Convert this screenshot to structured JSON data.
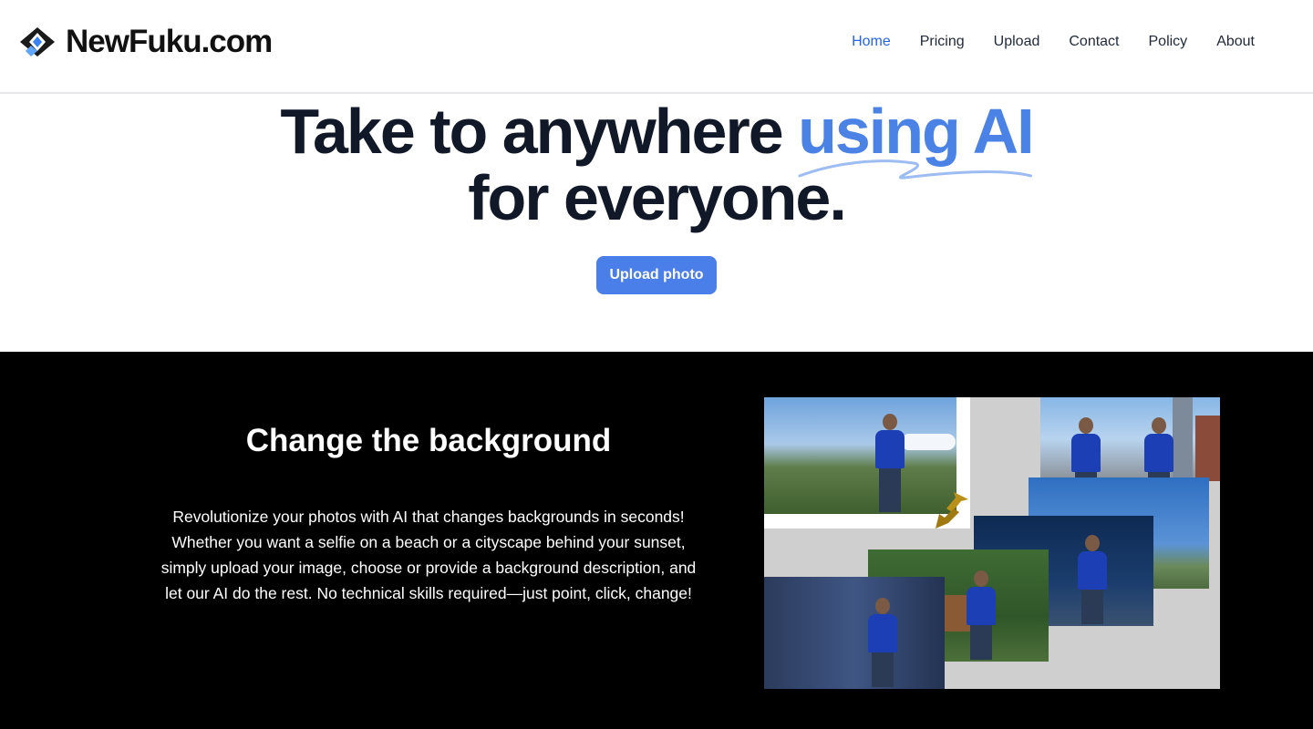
{
  "brand": {
    "name": "NewFuku.com",
    "logo_icon": "diamond-logo-icon"
  },
  "nav": {
    "items": [
      {
        "label": "Home",
        "active": true
      },
      {
        "label": "Pricing",
        "active": false
      },
      {
        "label": "Upload",
        "active": false
      },
      {
        "label": "Contact",
        "active": false
      },
      {
        "label": "Policy",
        "active": false
      },
      {
        "label": "About",
        "active": false
      }
    ]
  },
  "hero": {
    "title_part1": "Take to anywhere ",
    "title_accent": "using AI",
    "title_line2": "for everyone.",
    "cta_label": "Upload photo"
  },
  "feature": {
    "title": "Change the background",
    "description": "Revolutionize your photos with AI that changes backgrounds in seconds! Whether you want a selfie on a beach or a cityscape behind your sunset, simply upload your image, choose or provide a background description, and let our AI do the rest. No technical skills required—just point, click, change!"
  },
  "colors": {
    "accent": "#4b82e6",
    "nav_active": "#2563eb",
    "button": "#4a7ee8",
    "dark_bg": "#000000"
  }
}
